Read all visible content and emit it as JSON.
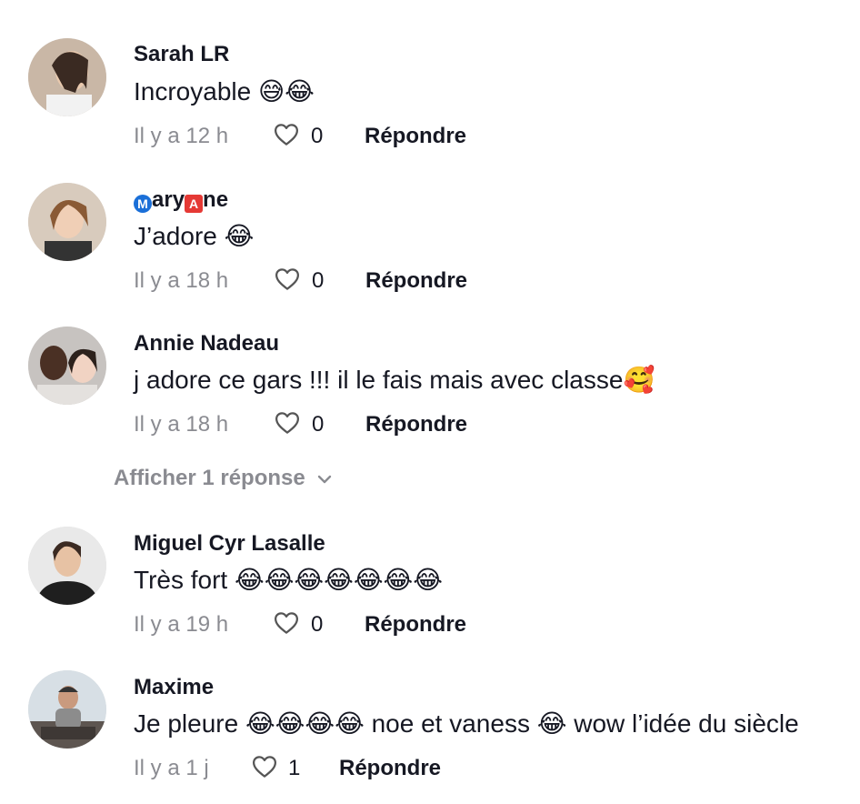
{
  "comments": [
    {
      "username": "Sarah LR",
      "text": "Incroyable 😅😂",
      "time": "Il y a 12 h",
      "likes": "0",
      "reply_label": "Répondre"
    },
    {
      "username_parts": [
        "M",
        "ary",
        "A",
        "ne"
      ],
      "text": "J’adore 😂",
      "time": "Il y a 18 h",
      "likes": "0",
      "reply_label": "Répondre"
    },
    {
      "username": "Annie Nadeau",
      "text": "j adore ce gars !!! il le fais mais avec classe🥰",
      "time": "Il y a 18 h",
      "likes": "0",
      "reply_label": "Répondre",
      "show_replies_label": "Afficher 1 réponse"
    },
    {
      "username": "Miguel Cyr Lasalle",
      "text": "Très fort 😂😂😂😂😂😂😂",
      "time": "Il y a 19 h",
      "likes": "0",
      "reply_label": "Répondre"
    },
    {
      "username": "Maxime",
      "text": "Je pleure 😂😂😂😂 noe et vaness 😂 wow l’idée du siècle",
      "time": "Il y a 1 j",
      "likes": "1",
      "reply_label": "Répondre"
    }
  ],
  "icons": {
    "like": "heart-outline-icon",
    "chevron": "chevron-down-icon",
    "badge_m": "circled-m-icon",
    "badge_a": "squared-a-icon"
  },
  "colors": {
    "text": "#161823",
    "muted": "#8a8b91",
    "badge_m": "#1a6fd8",
    "badge_a": "#e53935"
  }
}
